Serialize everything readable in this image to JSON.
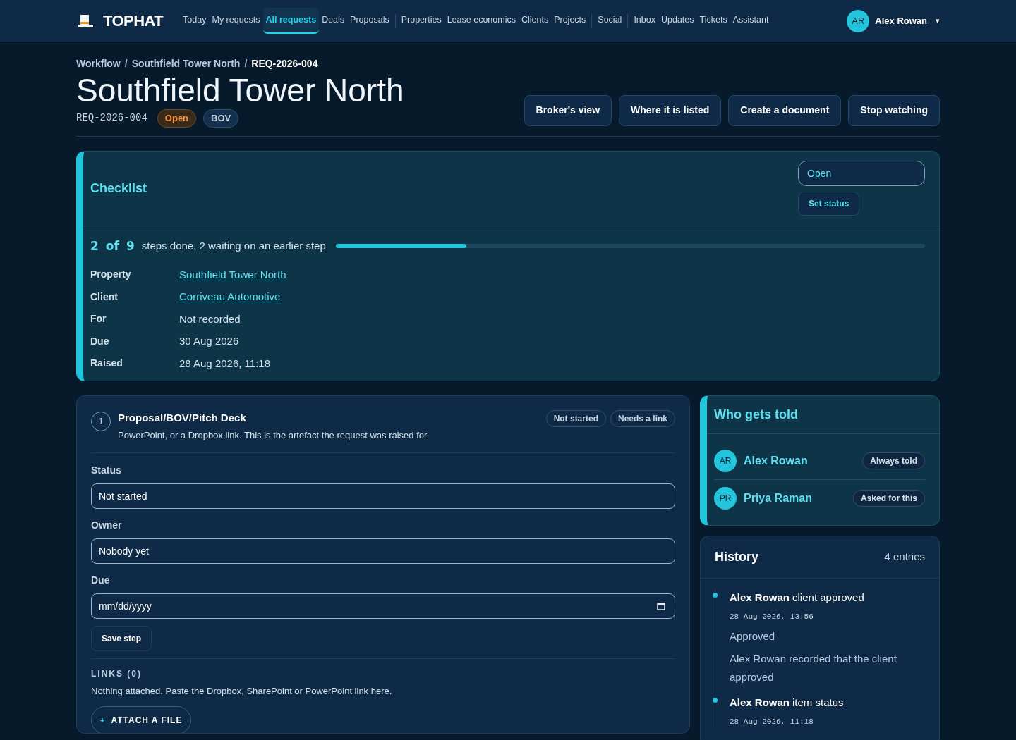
{
  "brand": {
    "name": "TOPHAT"
  },
  "nav": [
    [
      {
        "label": "Today",
        "selected": false
      },
      {
        "label": "My requests",
        "selected": false
      },
      {
        "label": "All requests",
        "selected": true
      },
      {
        "label": "Deals",
        "selected": false
      },
      {
        "label": "Proposals",
        "selected": false
      }
    ],
    [
      {
        "label": "Properties",
        "selected": false
      },
      {
        "label": "Lease economics",
        "selected": false
      },
      {
        "label": "Clients",
        "selected": false
      },
      {
        "label": "Projects",
        "selected": false
      }
    ],
    [
      {
        "label": "Social",
        "selected": false
      }
    ],
    [
      {
        "label": "Inbox",
        "selected": false
      },
      {
        "label": "Updates",
        "selected": false
      },
      {
        "label": "Tickets",
        "selected": false
      },
      {
        "label": "Assistant",
        "selected": false
      }
    ]
  ],
  "user": {
    "initials": "AR",
    "name": "Alex Rowan",
    "caret": "▾"
  },
  "breadcrumbs": [
    "Workflow",
    "Southfield Tower North",
    "REQ-2026-004"
  ],
  "breadcrumb_separator": "/",
  "title": "Southfield Tower North",
  "ref": "REQ-2026-004",
  "badges": [
    {
      "label": "Open",
      "kind": "status"
    },
    {
      "label": "BOV",
      "kind": "type"
    }
  ],
  "actions": [
    "Broker's view",
    "Where it is listed",
    "Create a document",
    "Stop watching"
  ],
  "checklist": {
    "title": "Checklist",
    "status_value": "Open",
    "set_status": "Set status",
    "progress": {
      "done": "2",
      "of": "of",
      "total": "9",
      "text": "steps done, 2 waiting on an earlier step",
      "level": 0.222
    },
    "details": [
      {
        "label": "Property",
        "value": "Southfield Tower North",
        "kind": "link"
      },
      {
        "label": "Client",
        "value": "Corriveau Automotive",
        "kind": "link"
      },
      {
        "label": "For",
        "value": "Not recorded",
        "kind": "text"
      },
      {
        "label": "Due",
        "value": "30 Aug 2026",
        "kind": "text"
      },
      {
        "label": "Raised",
        "value": "28 Aug 2026, 11:18",
        "kind": "text"
      }
    ]
  },
  "step": {
    "number": "1",
    "title": "Proposal/BOV/Pitch Deck",
    "description": "PowerPoint, or a Dropbox link. This is the artefact the request was raised for.",
    "tags": [
      "Not started",
      "Needs a link"
    ],
    "fields": [
      {
        "label": "Status",
        "value": "Not started",
        "kind": "select"
      },
      {
        "label": "Owner",
        "value": "Nobody yet",
        "kind": "select"
      },
      {
        "label": "Due",
        "placeholder": "mm/dd/yyyy",
        "kind": "date"
      }
    ],
    "save": "Save step",
    "links_heading": "LINKS (0)",
    "links_text": "Nothing attached. Paste the Dropbox, SharePoint or PowerPoint link here.",
    "attach": {
      "icon": "+",
      "label": "ATTACH A FILE"
    }
  },
  "notify": {
    "title": "Who gets told",
    "people": [
      {
        "initials": "AR",
        "name": "Alex Rowan",
        "tag": "Always told"
      },
      {
        "initials": "PR",
        "name": "Priya Raman",
        "tag": "Asked for this"
      }
    ]
  },
  "history": {
    "title": "History",
    "count": "4 entries",
    "entries": [
      {
        "who": "Alex Rowan",
        "action": "client approved",
        "time": "28 Aug 2026, 13:56",
        "lines": [
          "Approved",
          "Alex Rowan recorded that the client approved"
        ]
      },
      {
        "who": "Alex Rowan",
        "action": "item status",
        "time": "28 Aug 2026, 11:18"
      }
    ]
  }
}
